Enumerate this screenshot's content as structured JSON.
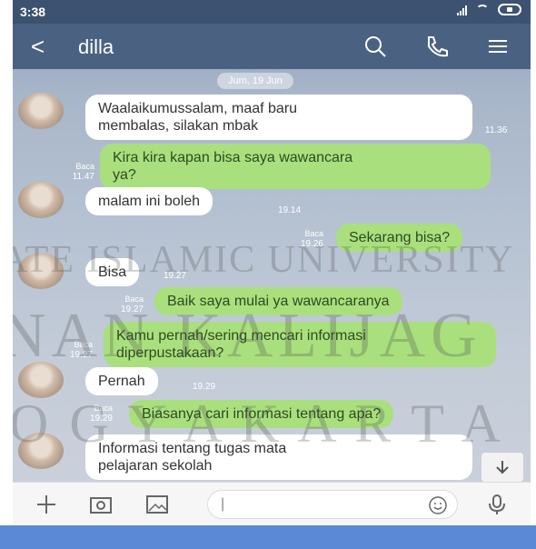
{
  "status_bar": {
    "time": "3:38"
  },
  "header": {
    "back_glyph": "<",
    "title": "dilla",
    "icons": [
      "search-icon",
      "phone-icon",
      "menu-icon"
    ]
  },
  "date_separator": "Jum, 19 Jun",
  "messages": [
    {
      "side": "in",
      "text_lines": [
        "Waalaikumussalam, maaf baru",
        "membalas, silakan mbak"
      ],
      "time": "11.36",
      "read": ""
    },
    {
      "side": "out",
      "text_lines": [
        "Kira kira kapan bisa saya wawancara",
        "ya?"
      ],
      "time": "11.47",
      "read": "Baca"
    },
    {
      "side": "in",
      "text_lines": [
        "malam ini boleh"
      ],
      "time": "19.14",
      "read": ""
    },
    {
      "side": "out",
      "text_lines": [
        "Sekarang bisa?"
      ],
      "time": "19.26",
      "read": "Baca"
    },
    {
      "side": "in",
      "text_lines": [
        "Bisa"
      ],
      "time": "19.27",
      "read": ""
    },
    {
      "side": "out",
      "text_lines": [
        "Baik saya mulai ya wawancaranya"
      ],
      "time": "19.27",
      "read": "Baca"
    },
    {
      "side": "out",
      "text_lines": [
        "Kamu pernah/sering mencari informasi",
        "diperpustakaan?"
      ],
      "time": "19.27",
      "read": "Baca"
    },
    {
      "side": "in",
      "text_lines": [
        "Pernah"
      ],
      "time": "19.29",
      "read": ""
    },
    {
      "side": "out",
      "text_lines": [
        "Biasanya cari informasi tentang apa?"
      ],
      "time": "19.29",
      "read": "Baca"
    },
    {
      "side": "in",
      "text_lines": [
        "Informasi tentang tugas mata",
        "pelajaran sekolah"
      ],
      "time": "",
      "read": ""
    }
  ],
  "watermark": {
    "line1": "ATE ISLAMIC UNIVERSITY",
    "line2": "NAN KALIJAG",
    "line3": "O G Y A K A R T A"
  },
  "composer": {
    "placeholder": "|",
    "icons": [
      "plus-icon",
      "camera-icon",
      "image-icon",
      "emoji-icon",
      "microphone-icon"
    ]
  },
  "colors": {
    "header": "#4a6182",
    "outgoing_bubble": "#a9e07d",
    "incoming_bubble": "#ffffff",
    "status_bar": "#3d5270"
  }
}
